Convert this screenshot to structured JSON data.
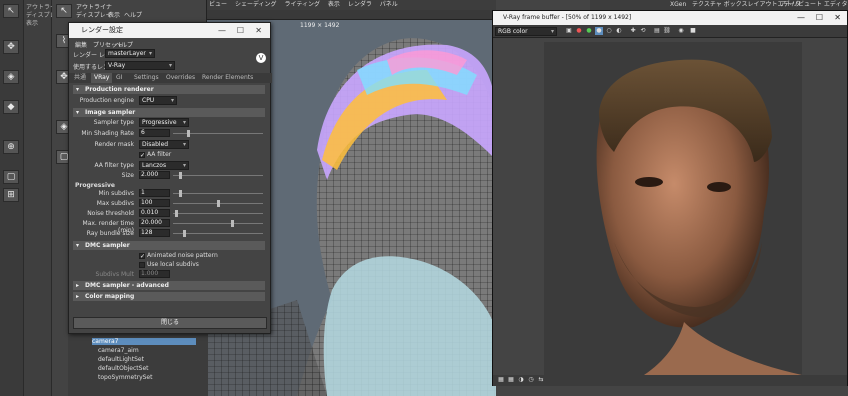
{
  "left_tools": {
    "labels": [
      "アウトライナ",
      "ディスプレイ",
      "表示"
    ]
  },
  "panel2": {
    "menu": [
      "アウトライナ",
      "ディスプレイ",
      "表示",
      "ヘルプ"
    ]
  },
  "viewport": {
    "menu": [
      "ビュー",
      "シェーディング",
      "ライティング",
      "表示",
      "レンダラ",
      "パネル"
    ],
    "resolution": "1199 × 1492"
  },
  "right_top": {
    "items": [
      "XGen",
      "テクスチャ ボックスレイアウトエディタ",
      "アトリビュート エディタ"
    ]
  },
  "render_settings": {
    "title": "レンダー設定",
    "menu": [
      "編集",
      "プリセット",
      "ヘルプ"
    ],
    "render_layer_label": "レンダー レイヤ",
    "render_layer_value": "masterLayer",
    "renderer_label": "使用するレンダラ",
    "renderer_value": "V-Ray",
    "tabs": [
      "共通",
      "VRay",
      "GI",
      "Settings",
      "Overrides",
      "Render Elements"
    ],
    "active_tab": "VRay",
    "sections": {
      "production_renderer": "Production renderer",
      "image_sampler": "Image sampler",
      "dmc_sampler": "DMC sampler",
      "dmc_advanced": "DMC sampler - advanced",
      "color_mapping": "Color mapping"
    },
    "production_engine_label": "Production engine",
    "production_engine_value": "CPU",
    "sampler_type_label": "Sampler type",
    "sampler_type_value": "Progressive",
    "min_shading_rate_label": "Min Shading Rate",
    "min_shading_rate_value": "6",
    "render_mask_label": "Render mask",
    "render_mask_value": "Disabled",
    "aa_filter_label": "AA filter",
    "aa_filter_type_label": "AA filter type",
    "aa_filter_type_value": "Lanczos",
    "size_label": "Size",
    "size_value": "2.000",
    "progressive_label": "Progressive",
    "min_subdivs_label": "Min subdivs",
    "min_subdivs_value": "1",
    "max_subdivs_label": "Max subdivs",
    "max_subdivs_value": "100",
    "noise_threshold_label": "Noise threshold",
    "noise_threshold_value": "0.010",
    "max_render_time_label": "Max. render time (min)",
    "max_render_time_value": "20.000",
    "ray_bundle_label": "Ray bundle size",
    "ray_bundle_value": "128",
    "animated_noise_label": "Animated noise pattern",
    "use_local_subdivs_label": "Use local subdivs",
    "subdivs_mult_label": "Subdivs Mult",
    "subdivs_mult_value": "1.000",
    "close_label": "閉じる"
  },
  "outliner": {
    "items": [
      "camera7",
      "camera7_aim",
      "defaultLightSet",
      "defaultObjectSet",
      "topoSymmetrySet"
    ]
  },
  "vfb": {
    "title": "V-Ray frame buffer - [50% of 1199 x 1492]",
    "channel": "RGB color"
  }
}
